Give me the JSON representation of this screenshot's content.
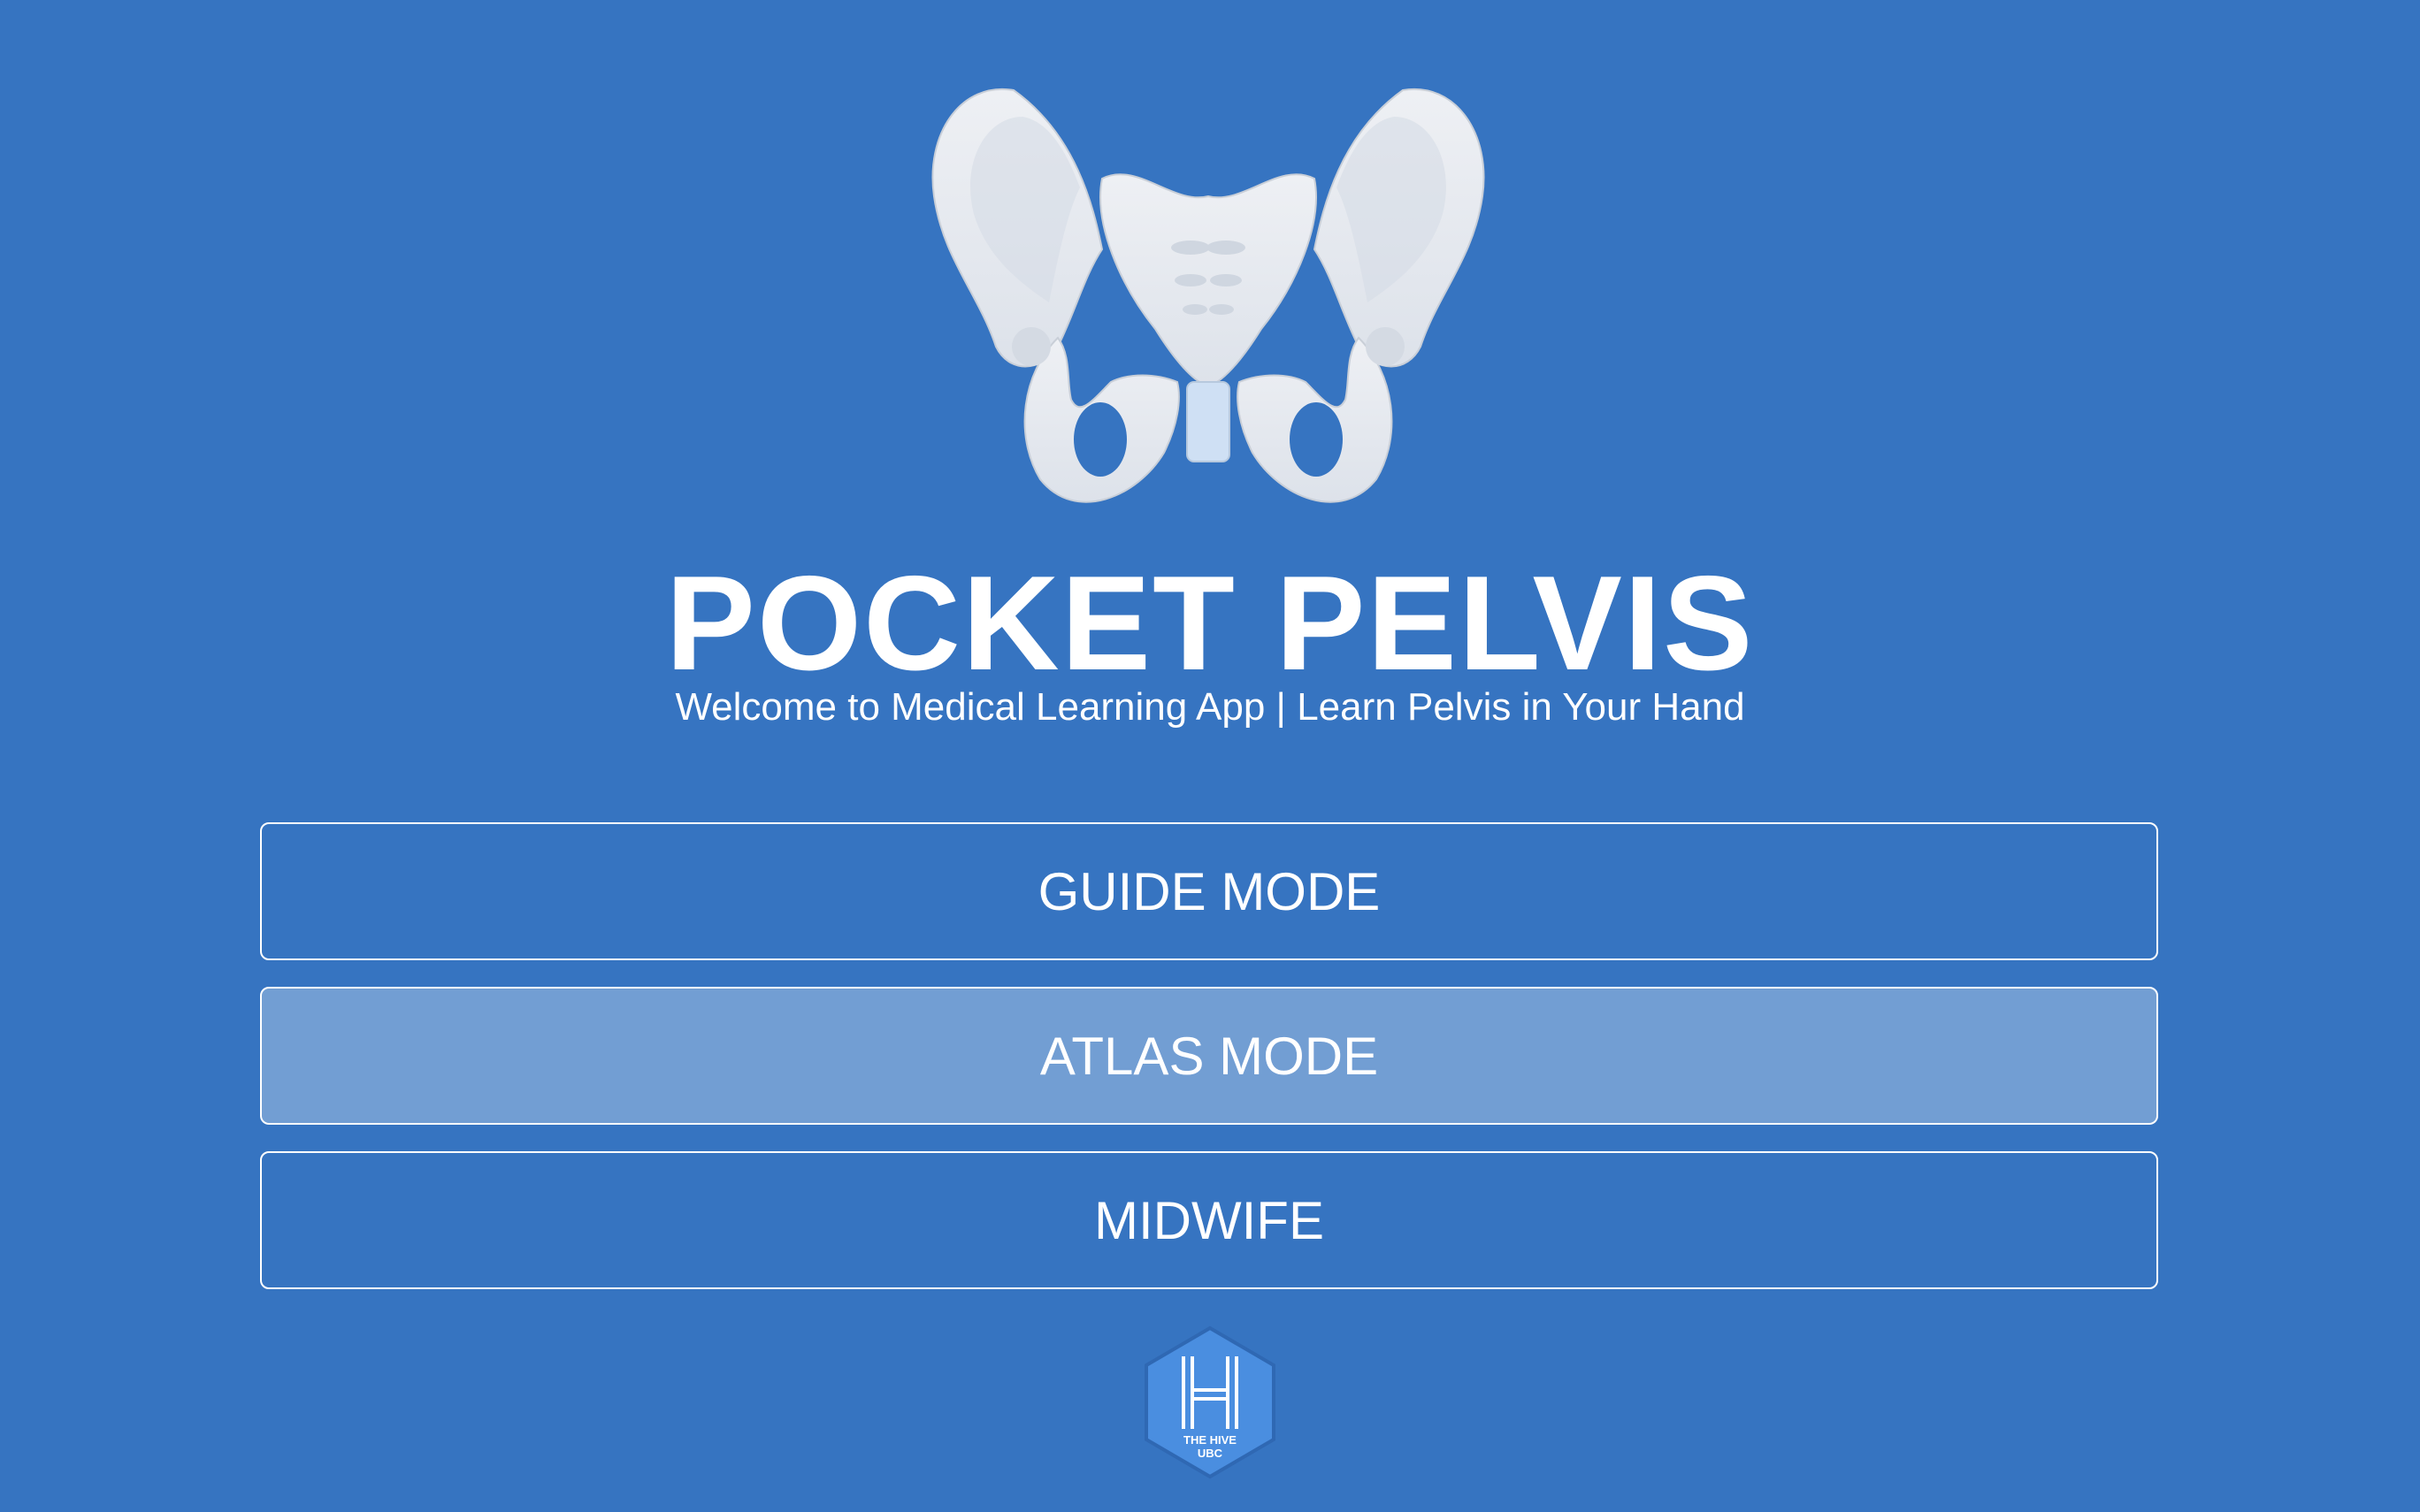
{
  "app": {
    "title": "POCKET PELVIS",
    "subtitle": "Welcome to Medical Learning App | Learn Pelvis in Your Hand"
  },
  "modes": [
    {
      "label": "GUIDE MODE",
      "selected": false
    },
    {
      "label": "ATLAS MODE",
      "selected": true
    },
    {
      "label": "MIDWIFE",
      "selected": false
    }
  ],
  "footer": {
    "logo_line1": "THE HIVE",
    "logo_line2": "UBC"
  },
  "colors": {
    "background": "#3674c1",
    "bone": "#e6e9ee",
    "highlight_button": "rgba(255,255,255,0.3)",
    "logo_fill": "#4a8ee0"
  },
  "icons": {
    "hero": "pelvis-illustration",
    "footer": "hive-logo"
  }
}
